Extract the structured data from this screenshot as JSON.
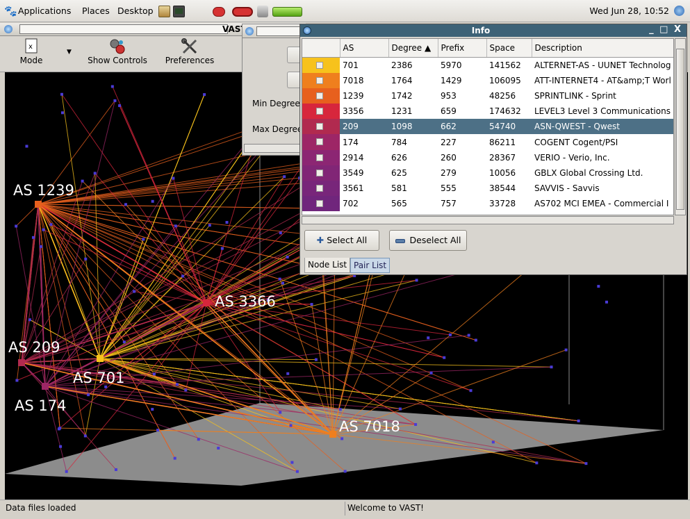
{
  "panel": {
    "menus": [
      "Applications",
      "Places",
      "Desktop"
    ],
    "clock": "Wed Jun 28, 10:52"
  },
  "window": {
    "title": "VAST"
  },
  "toolbar": {
    "mode_label": "Mode",
    "controls_label": "Show Controls",
    "prefs_label": "Preferences"
  },
  "controls_panel": {
    "min_degree_label": "Min Degree",
    "max_degree_label": "Max Degree"
  },
  "info": {
    "title": "Info",
    "window_controls": "_ □ X",
    "columns": [
      "AS",
      "Degree ▲",
      "Prefix",
      "Space",
      "Description"
    ],
    "rows": [
      {
        "color": "#f7c21c",
        "as": "701",
        "degree": "2386",
        "prefix": "5970",
        "space": "141562",
        "description": "ALTERNET-AS - UUNET Technolog"
      },
      {
        "color": "#ef7f1e",
        "as": "7018",
        "degree": "1764",
        "prefix": "1429",
        "space": "106095",
        "description": "ATT-INTERNET4 - AT&amp;T Worl"
      },
      {
        "color": "#e7601e",
        "as": "1239",
        "degree": "1742",
        "prefix": "953",
        "space": "48256",
        "description": "SPRINTLINK - Sprint"
      },
      {
        "color": "#d7263c",
        "as": "3356",
        "degree": "1231",
        "prefix": "659",
        "space": "174632",
        "description": "LEVEL3 Level 3 Communications"
      },
      {
        "color": "#b12a4f",
        "as": "209",
        "degree": "1098",
        "prefix": "662",
        "space": "54740",
        "description": "ASN-QWEST - Qwest"
      },
      {
        "color": "#9d2666",
        "as": "174",
        "degree": "784",
        "prefix": "227",
        "space": "86211",
        "description": "COGENT Cogent/PSI"
      },
      {
        "color": "#8c2673",
        "as": "2914",
        "degree": "626",
        "prefix": "260",
        "space": "28367",
        "description": "VERIO - Verio, Inc."
      },
      {
        "color": "#812676",
        "as": "3549",
        "degree": "625",
        "prefix": "279",
        "space": "10056",
        "description": "GBLX Global Crossing Ltd."
      },
      {
        "color": "#78267a",
        "as": "3561",
        "degree": "581",
        "prefix": "555",
        "space": "38544",
        "description": "SAVVIS - Savvis"
      },
      {
        "color": "#70267c",
        "as": "702",
        "degree": "565",
        "prefix": "757",
        "space": "33728",
        "description": "AS702 MCI EMEA - Commercial I"
      }
    ],
    "selected_row": 4,
    "select_all": "Select All",
    "deselect_all": "Deselect All",
    "tab_node_list": "Node List",
    "tab_pair_list": "Pair List"
  },
  "viz": {
    "labels": {
      "as1239": "AS 1239",
      "as3366": "AS 3366",
      "as209": "AS 209",
      "as701": "AS 701",
      "as174": "AS 174",
      "as7018": "AS 7018"
    }
  },
  "status": {
    "left": "Data files loaded",
    "middle": "Welcome to VAST!"
  }
}
